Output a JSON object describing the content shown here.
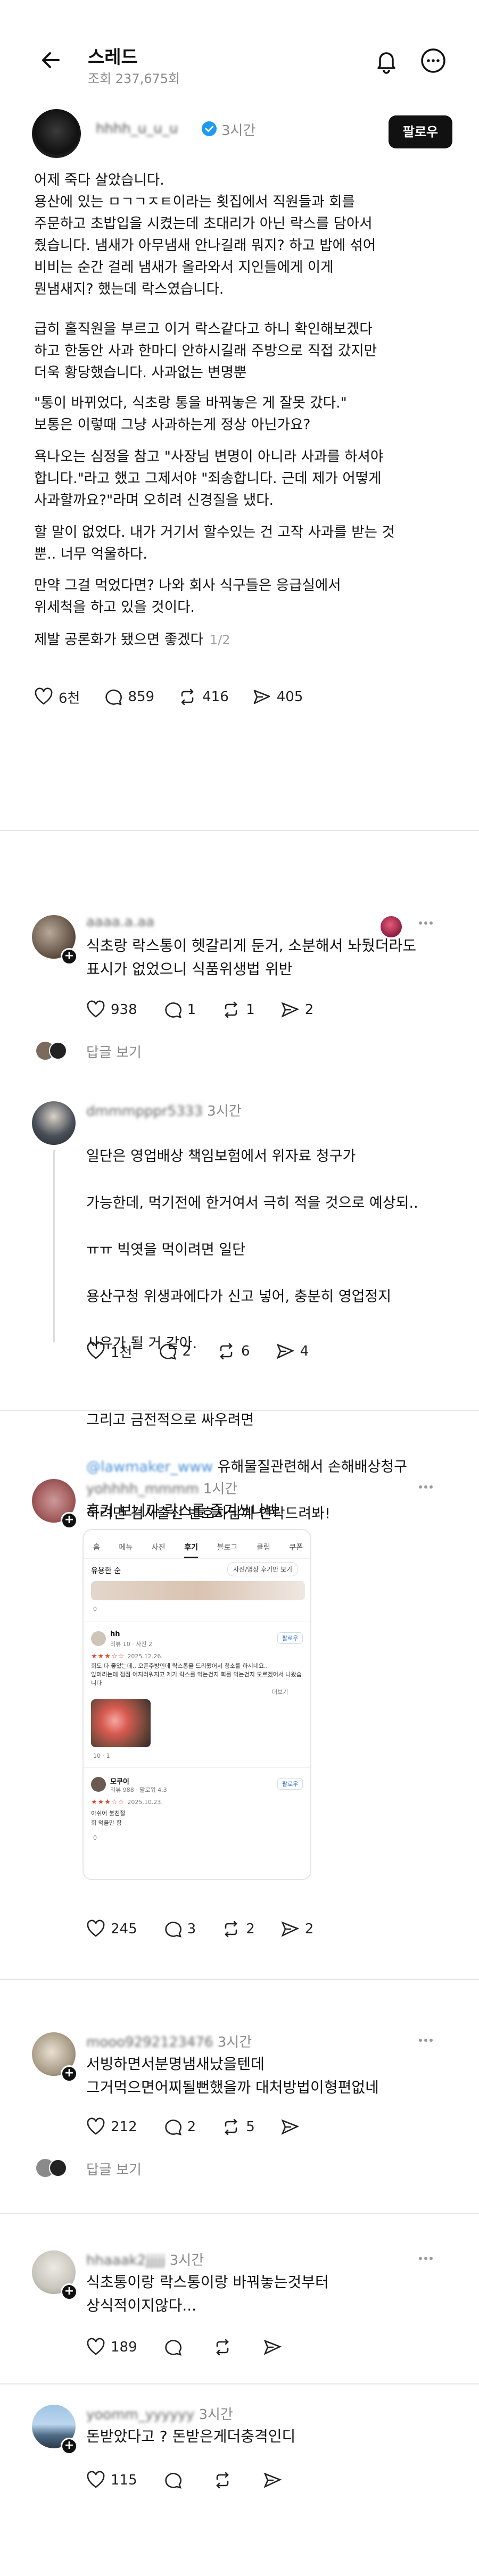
{
  "header": {
    "title": "스레드",
    "views": "조회 237,675회"
  },
  "post": {
    "author": "hhhh_u_u_u",
    "time": "3시간",
    "follow_label": "팔로우",
    "paragraphs": [
      "어제 죽다 살았습니다.\n용산에 있는 ㅁㄱㄱㅈㅌ이라는 횟집에서 직원들과 회를\n주문하고 초밥입을 시켰는데 초대리가 아닌 락스를 담아서\n줬습니다. 냄새가 아무냄새 안나길래 뭐지? 하고 밥에 섞어\n비비는 순간 걸레 냄새가 올라와서 지인들에게 이게\n뭔냄새지? 했는데 락스였습니다.",
      "급히 홀직원을 부르고 이거 락스같다고 하니 확인해보겠다\n하고 한동안 사과 한마디 안하시길래 주방으로 직접 갔지만\n더욱 황당했습니다. 사과없는 변명뿐",
      "\"통이 바뀌었다, 식초랑 통을 바꿔놓은 게 잘못 갔다.\"\n보통은 이렇때 그냥 사과하는게 정상 아닌가요?",
      "욕나오는 심정을 참고 \"사장님 변명이 아니라 사과를 하셔야\n합니다.\"라고 했고 그제서야 \"죄송합니다. 근데 제가 어떻게\n사과할까요?\"라며 오히려 신경질을 냈다.",
      "할 말이 없었다. 내가 거기서 할수있는 건 고작 사과를 받는 것\n뿐.. 너무 억울하다.",
      "만약 그걸 먹었다면? 나와 회사 식구들은 응급실에서\n위세척을 하고 있을 것이다."
    ],
    "last_line": "제발 공론화가 됐으면 좋겠다",
    "pager": "1/2",
    "likes": "6천",
    "comments": "859",
    "reposts": "416",
    "shares": "405"
  },
  "replies": [
    {
      "name": "aaaa.a.aa",
      "time": "",
      "text": "식초랑 락스통이 헷갈리게 둔거, 소분해서 놔뒀더라도\n표시가 없었으니 식품위생법 위반",
      "likes": "938",
      "comments": "1",
      "reposts": "1",
      "shares": "2",
      "view_replies": "답글 보기"
    },
    {
      "name": "dmmmpppr5333",
      "time": "3시간",
      "text_lines": [
        "일단은 영업배상 책임보험에서 위자료 청구가",
        "가능한데, 먹기전에 한거여서 극히 적을 것으로 예상되..",
        "ㅠㅠ 빅엿을 먹이려면 일단",
        "용산구청 위생과에다가 신고 넣어, 충분히 영업정지",
        "사유가 될 거 같아.",
        "",
        "그리고 금전적으로 싸우려면",
        "유해물질관련해서 손해배상청구",
        "하려면 검사출신 변호사님께 연락드려봐!"
      ],
      "link_text": "@lawmaker_www",
      "likes": "1천",
      "comments": "2",
      "reposts": "6",
      "shares": "4"
    },
    {
      "name": "yohhhh_mmmm",
      "time": "1시간",
      "text": "후기 보니까 락스를 즐겨쓰나봐",
      "likes": "245",
      "comments": "3",
      "reposts": "2",
      "shares": "2"
    },
    {
      "name": "mooo9292123476",
      "time": "3시간",
      "text": "서빙하면서분명냄새났을텐데\n그거먹으면어찌될뻔했을까 대처방법이형편없네",
      "likes": "212",
      "comments": "2",
      "reposts": "5",
      "shares": "",
      "view_replies": "답글 보기"
    },
    {
      "name": "hhaaak2jjjjj",
      "time": "3시간",
      "text": "식초통이랑 락스통이랑 바꿔놓는것부터\n상식적이지않다...",
      "likes": "189",
      "comments": "",
      "reposts": "",
      "shares": ""
    },
    {
      "name": "yoomm_yyyyyy",
      "time": "3시간",
      "text": "돈받았다고 ? 돈받은게더충격인디",
      "likes": "115",
      "comments": "",
      "reposts": "",
      "shares": ""
    }
  ],
  "embed": {
    "shop": "ㅁㄱㄱㅈㅌ",
    "tabs": [
      "홈",
      "메뉴",
      "사진",
      "후기",
      "블로그",
      "클립",
      "쿠폰"
    ],
    "active_tab": "후기",
    "sort": "유용한 순",
    "filter": "사진/영상 후기만 보기",
    "top_count": "0",
    "review1": {
      "name": "hh",
      "stats": "리뷰 10 · 사진 2",
      "date": "2025.12.26.",
      "text": "회도 다 좋았는데.. 오픈주방인데 락스통을 드리웠어서 청소를 하시네요..\n앞머리는데 점점 어지러워지고 제가 락스를 먹는건지 회를 먹는건지 모르겠어서 나왔습니다",
      "more": "더보기",
      "follow": "팔로우",
      "likes": "10",
      "comments": "1"
    },
    "review2": {
      "name": "모쿠이",
      "stats": "리뷰 988 · 팔로워 4.3",
      "date": "2025.10.23.",
      "line1": "아쉬어 불친절",
      "line2": "회 먹을만 함",
      "follow": "팔로우",
      "count": "0"
    }
  }
}
